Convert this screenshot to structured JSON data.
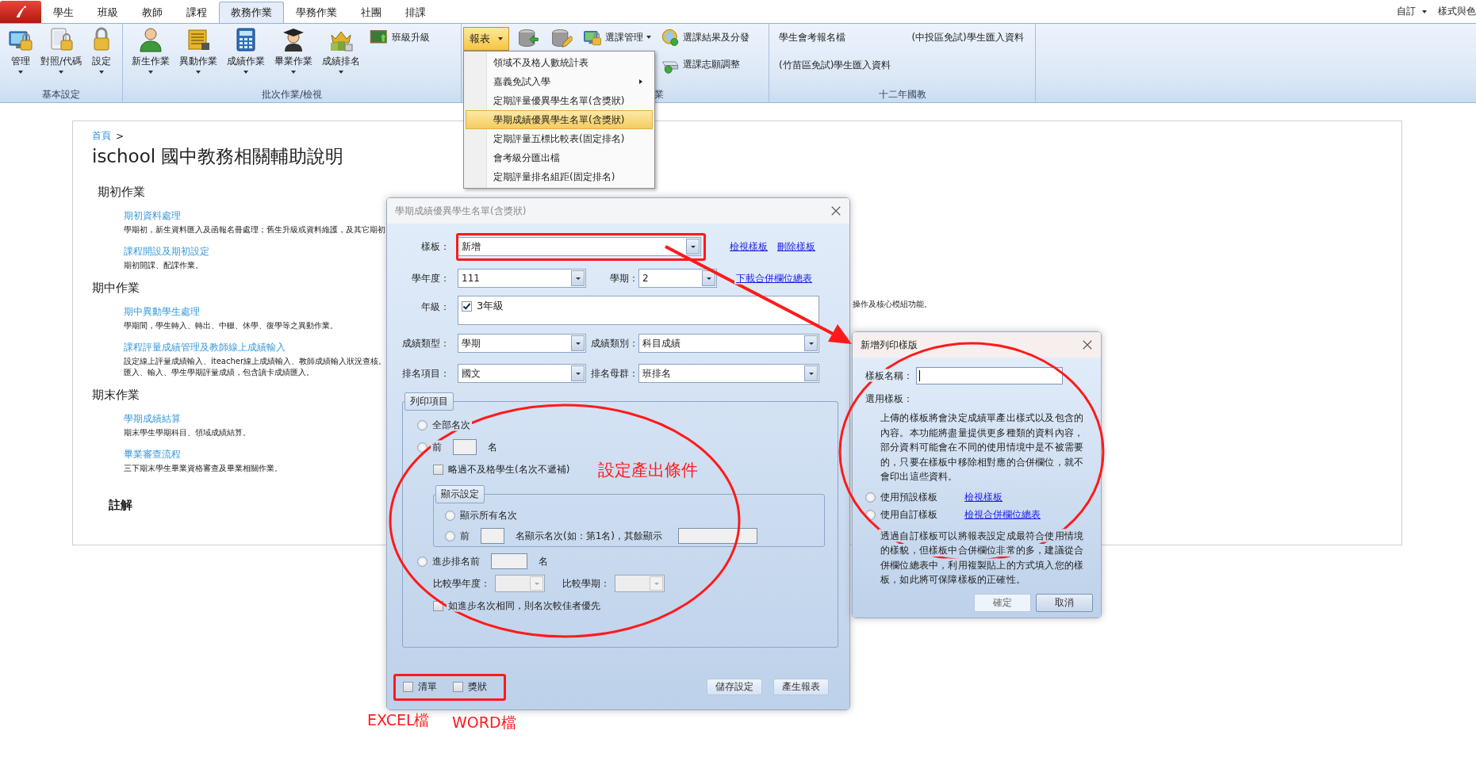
{
  "ribbon": {
    "tabs": [
      {
        "label": "學生",
        "selected": false
      },
      {
        "label": "班級",
        "selected": false
      },
      {
        "label": "教師",
        "selected": false
      },
      {
        "label": "課程",
        "selected": false
      },
      {
        "label": "教務作業",
        "selected": true
      },
      {
        "label": "學務作業",
        "selected": false
      },
      {
        "label": "社團",
        "selected": false
      },
      {
        "label": "排課",
        "selected": false
      }
    ],
    "right_items": [
      {
        "label": "自訂",
        "dropdown": true
      },
      {
        "label": "樣式與色",
        "dropdown": false
      }
    ],
    "groups": [
      {
        "label": "基本設定",
        "buttons": [
          {
            "kind": "large",
            "label": "管理",
            "dropdown": true
          },
          {
            "kind": "large",
            "label": "對照/代碼",
            "dropdown": true
          },
          {
            "kind": "large",
            "label": "設定",
            "dropdown": true
          }
        ]
      },
      {
        "label": "批次作業/檢視",
        "buttons": [
          {
            "kind": "large",
            "label": "新生作業",
            "dropdown": true
          },
          {
            "kind": "large",
            "label": "異動作業",
            "dropdown": true
          },
          {
            "kind": "large",
            "label": "成績作業",
            "dropdown": true
          },
          {
            "kind": "large",
            "label": "畢業作業",
            "dropdown": true
          },
          {
            "kind": "large",
            "label": "成績排名",
            "dropdown": true
          },
          {
            "kind": "stack",
            "buttons": [
              {
                "kind": "small",
                "label": "班級升級"
              }
            ]
          }
        ]
      },
      {
        "label": "業",
        "buttons": [
          {
            "kind": "menu",
            "label": "報表",
            "dropdown": true,
            "pressed": true
          },
          {
            "kind": "icon"
          },
          {
            "kind": "icon"
          },
          {
            "kind": "stack",
            "buttons": [
              {
                "kind": "small",
                "label": "選課管理",
                "dropdown": true
              }
            ]
          },
          {
            "kind": "stack",
            "buttons": [
              {
                "kind": "small",
                "label": "選課結果及分發"
              },
              {
                "kind": "small",
                "label": "選課志願調整"
              }
            ]
          }
        ]
      },
      {
        "label": "十二年國教",
        "buttons": [
          {
            "kind": "stack",
            "buttons": [
              {
                "kind": "text",
                "label": "學生會考報名檔"
              },
              {
                "kind": "text",
                "label": "(竹苗區免試)學生匯入資料"
              }
            ]
          },
          {
            "kind": "stack",
            "buttons": [
              {
                "kind": "text",
                "label": "(中投區免試)學生匯入資料"
              }
            ]
          }
        ]
      }
    ]
  },
  "report_menu": {
    "items": [
      {
        "label": "領域不及格人數統計表",
        "submenu": false,
        "selected": false
      },
      {
        "label": "嘉義免試入學",
        "submenu": true,
        "selected": false
      },
      {
        "label": "定期評量優異學生名單(含獎狀)",
        "submenu": false,
        "selected": false
      },
      {
        "label": "學期成績優異學生名單(含獎狀)",
        "submenu": false,
        "selected": true
      },
      {
        "label": "定期評量五標比較表(固定排名)",
        "submenu": false,
        "selected": false
      },
      {
        "label": "會考級分匯出檔",
        "submenu": false,
        "selected": false
      },
      {
        "label": "定期評量排名組距(固定排名)",
        "submenu": false,
        "selected": false
      }
    ]
  },
  "help_page": {
    "breadcrumb": {
      "link": "首頁",
      "separator": ">"
    },
    "title": "ischool 國中教務相關輔助說明",
    "sections": [
      {
        "heading": "期初作業",
        "items": [
          {
            "link": "期初資料處理",
            "description": [
              "學期初，新生資料匯入及函報名冊處理；舊生升級或資料維護，及其它期初"
            ]
          },
          {
            "link": "課程開設及期初設定",
            "description": [
              "期初開課、配課作業。"
            ]
          }
        ]
      },
      {
        "heading": "期中作業",
        "items": [
          {
            "link": "期中異動學生處理",
            "description": [
              "學期間，學生轉入、轉出、中輟、休學、復學等之異動作業。"
            ]
          },
          {
            "link": "課程評量成績管理及教師線上成績輸入",
            "description": [
              "設定線上評量成績輸入、iteacher線上成績輸入、教師成績輸入狀況查核。",
              "匯入、輸入、學生學期評量成績，包含讀卡成績匯入。"
            ]
          }
        ]
      },
      {
        "heading": "期末作業",
        "items": [
          {
            "link": "學期成績結算",
            "description": [
              "期末學生學期科目、領域成績結算。"
            ]
          },
          {
            "link": "畢業審查流程",
            "description": [
              "三下期末學生畢業資格審查及畢業相關作業。"
            ]
          }
        ]
      }
    ],
    "note_heading": "註解",
    "fragment": "操作及核心模組功能。"
  },
  "report_dialog": {
    "title": "學期成績優異學生名單(含獎狀)",
    "template": {
      "label": "樣板：",
      "value": "新增"
    },
    "template_links": [
      "檢視樣板",
      "刪除樣板"
    ],
    "school_year": {
      "label": "學年度：",
      "value": "111"
    },
    "semester": {
      "label": "學期：",
      "value": "2"
    },
    "download_link": "下載合併欄位總表",
    "grade": {
      "label": "年級：",
      "options": [
        {
          "label": "3年級",
          "checked": true
        }
      ]
    },
    "score_type": {
      "label": "成績類型：",
      "value": "學期"
    },
    "score_category": {
      "label": "成績類別：",
      "value": "科目成績"
    },
    "rank_item": {
      "label": "排名項目：",
      "value": "國文"
    },
    "rank_group": {
      "label": "排名母群：",
      "value": "班排名"
    },
    "print_items": {
      "legend": "列印項目",
      "all_ranks": {
        "label": "全部名次",
        "selected": false
      },
      "top_n": {
        "prefix": "前",
        "suffix": "名",
        "selected": false
      },
      "skip_failed": {
        "label": "略過不及格學生(名次不遞補)",
        "checked": false
      },
      "display": {
        "legend": "顯示設定",
        "show_all": {
          "label": "顯示所有名次",
          "selected": false
        },
        "top_n": {
          "prefix": "前",
          "middle": "名顯示名次(如：第1名)，其餘顯示",
          "selected": false
        }
      },
      "progress": {
        "prefix": "進步排名前",
        "suffix": "名",
        "selected": false,
        "year_label": "比較學年度：",
        "semester_label": "比較學期：",
        "tie": {
          "label": "如進步名次相同，則名次較佳者優先",
          "checked": false
        }
      }
    },
    "outputs": [
      {
        "label": "清單",
        "checked": false
      },
      {
        "label": "獎狀",
        "checked": false
      }
    ],
    "buttons": [
      "儲存設定",
      "產生報表"
    ]
  },
  "template_dialog": {
    "title": "新增列印樣版",
    "name_label": "樣板名稱：",
    "template_label": "選用樣板：",
    "intro": "上傳的樣板將會決定成績單產出樣式以及包含的內容。本功能將盡量提供更多種類的資料內容，部分資料可能會在不同的使用情境中是不被需要的，只要在樣板中移除相對應的合併欄位，就不會印出這些資料。",
    "options": [
      {
        "label": "使用預設樣板",
        "link": "檢視樣板",
        "selected": false
      },
      {
        "label": "使用自訂樣板",
        "link": "檢視合併欄位總表",
        "selected": false
      }
    ],
    "custom_note": "透過自訂樣板可以將報表設定成最符合使用情境的樣貌，但樣板中合併欄位非常的多，建議從合併欄位總表中，利用複製貼上的方式填入您的樣板，如此將可保障樣板的正確性。",
    "buttons": [
      {
        "label": "確定",
        "default": true
      },
      {
        "label": "取消",
        "default": false
      }
    ]
  },
  "annotations": {
    "condition_note": "設定產出條件",
    "output_labels": [
      "EXCEL檔",
      "WORD檔"
    ]
  }
}
